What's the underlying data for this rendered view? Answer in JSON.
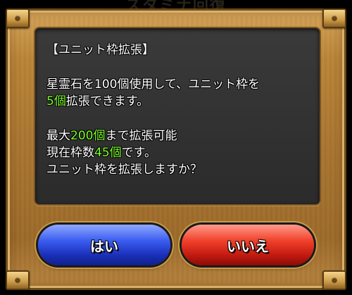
{
  "header": {
    "ghost_title": "スタミナ回復"
  },
  "dialog": {
    "title": "【ユニット枠拡張】",
    "line1": "星霊石を100個使用して、ユニット枠を",
    "line2_value": "5個",
    "line2_rest": "拡張できます。",
    "line3_pre": "最大",
    "line3_value": "200個",
    "line3_post": "まで拡張可能",
    "line4_pre": "現在枠数",
    "line4_value": "45個",
    "line4_post": "です。",
    "line5": "ユニット枠を拡張しますか？"
  },
  "buttons": {
    "yes_label": "はい",
    "no_label": "いいえ"
  },
  "colors": {
    "highlight": "#7cff2a",
    "yes_button": "#2a45d8",
    "no_button": "#d8281a",
    "frame": "#b07a34"
  }
}
